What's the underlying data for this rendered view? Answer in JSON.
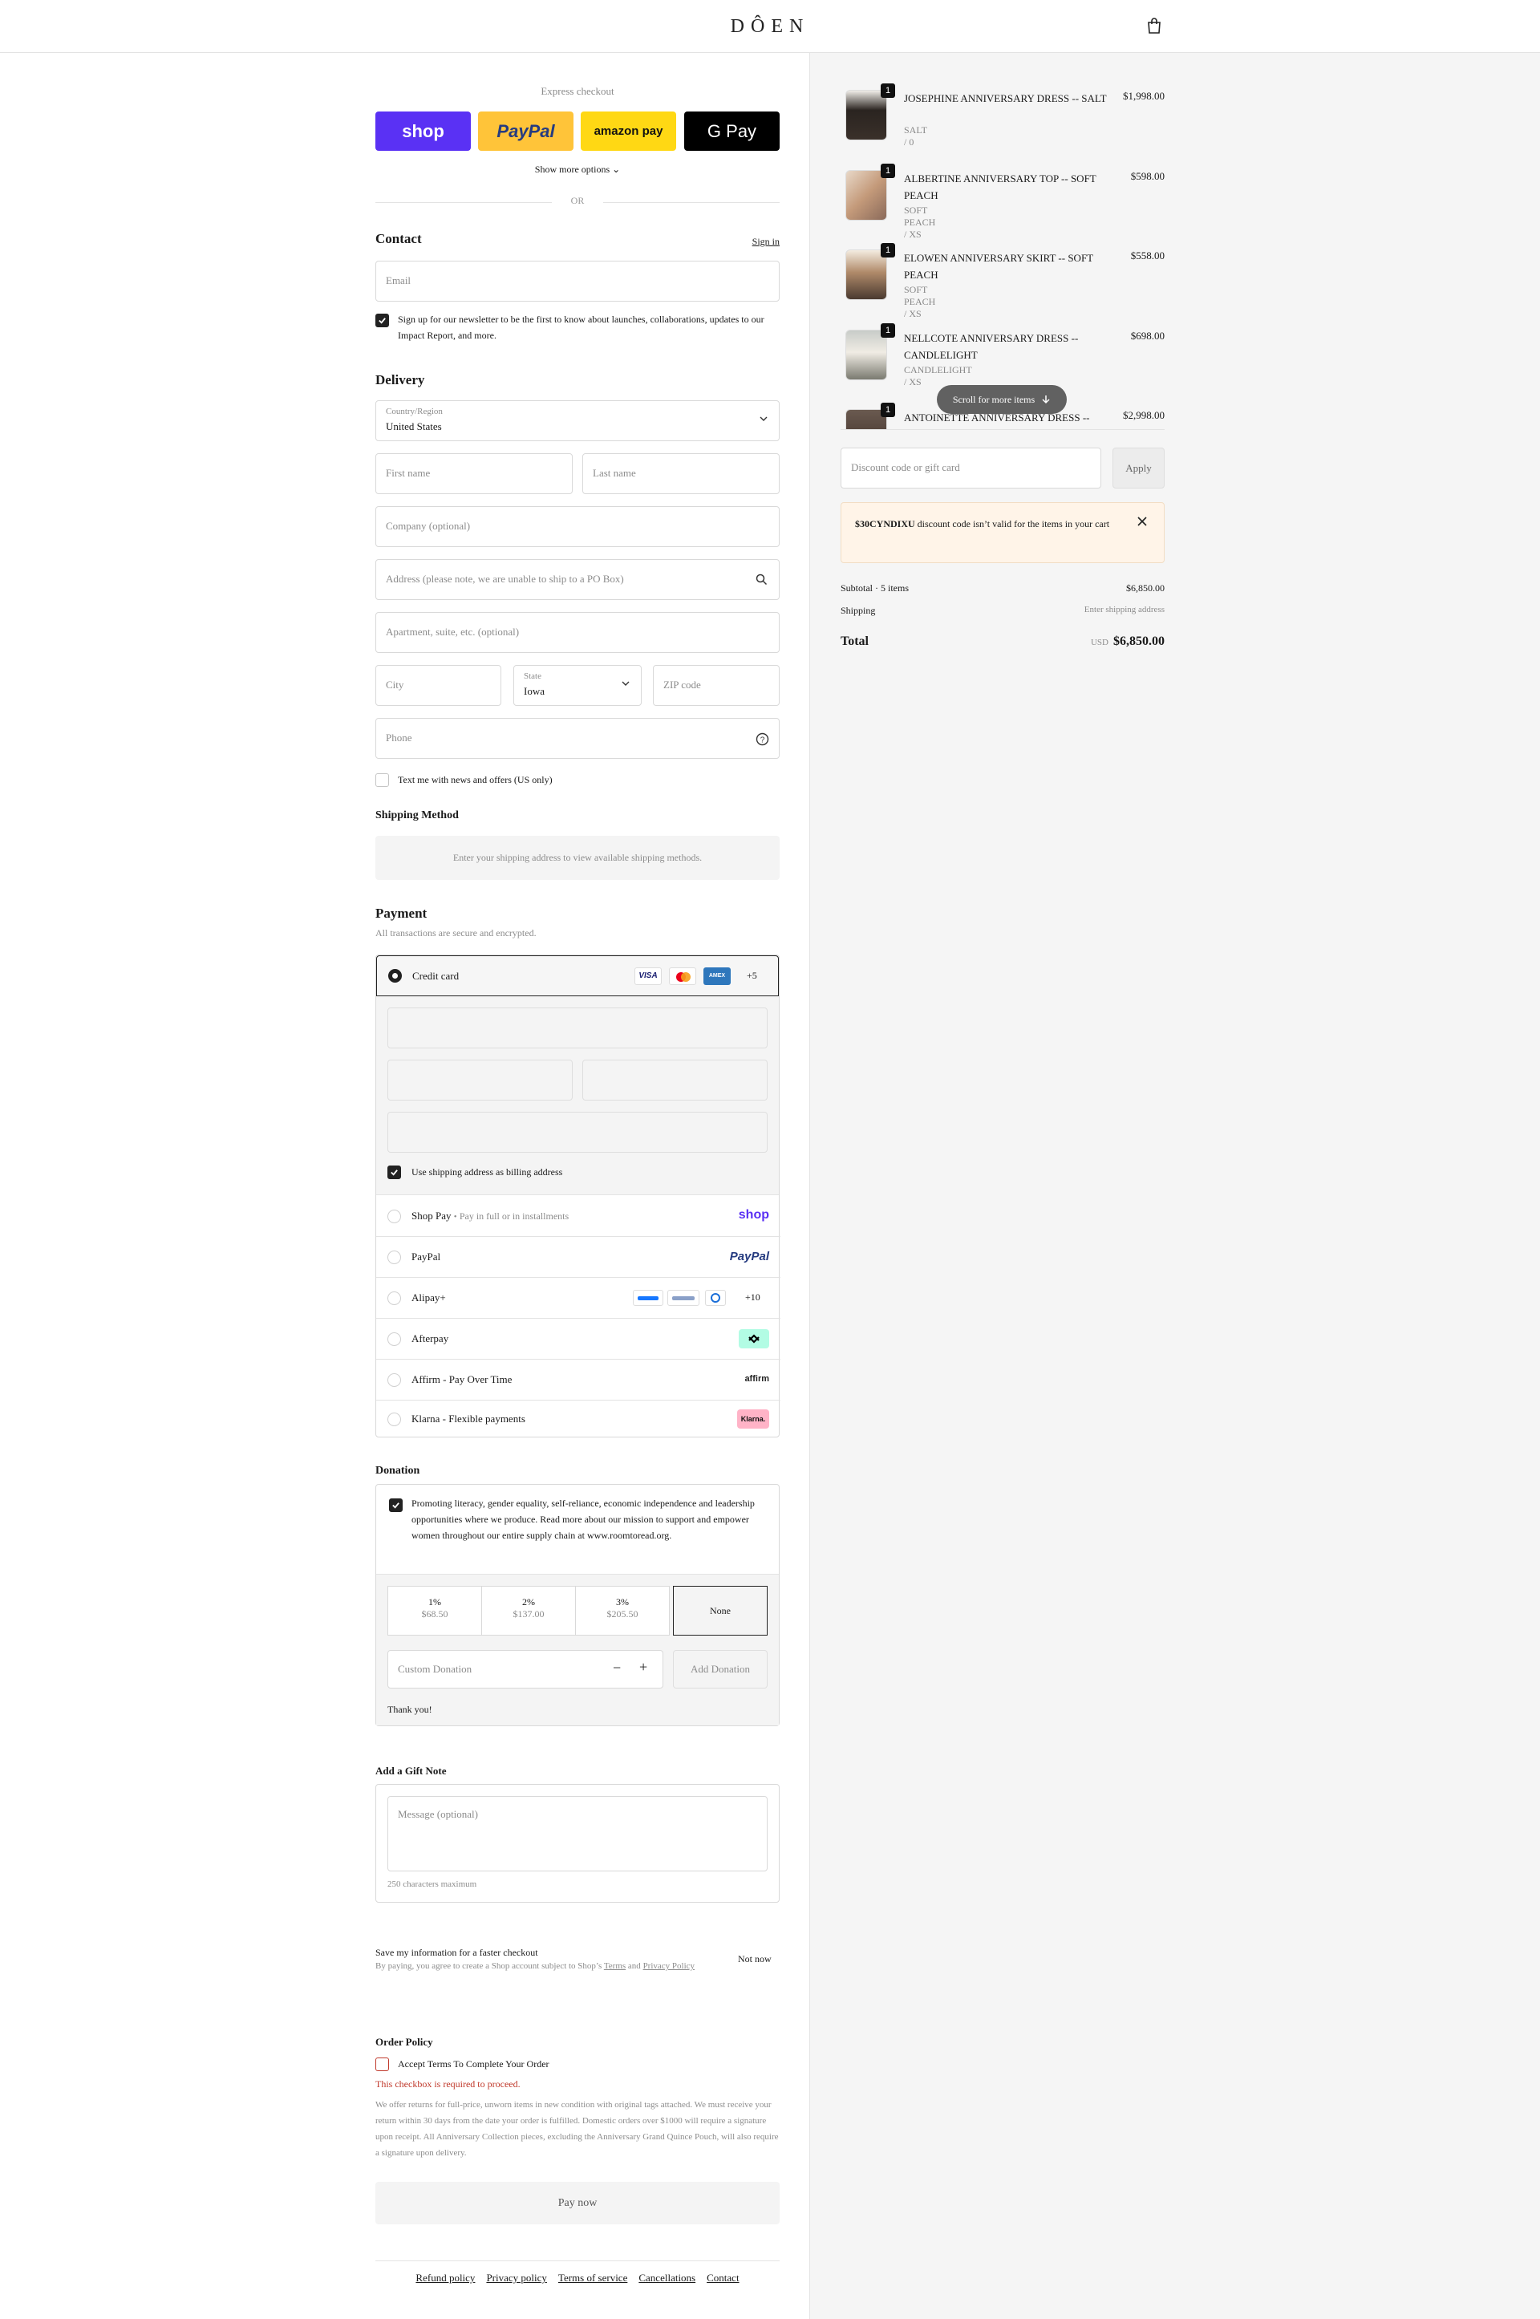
{
  "header": {
    "logo": "DÔEN",
    "cart_icon": "shopping-bag-icon"
  },
  "express": {
    "title": "Express checkout",
    "buttons": [
      {
        "label": "shop",
        "bg": "#5a31f4",
        "fg": "#ffffff"
      },
      {
        "label": "PayPal",
        "bg": "#ffc439",
        "fg": "#253b80"
      },
      {
        "label": "amazon pay",
        "bg": "#ffd814",
        "fg": "#111111"
      },
      {
        "label": "G Pay",
        "bg": "#000000",
        "fg": "#ffffff"
      }
    ],
    "show_more": "Show more options",
    "or": "OR"
  },
  "contact": {
    "title": "Contact",
    "sign_in": "Sign in",
    "email_placeholder": "Email",
    "newsletter": "Sign up for our newsletter to be the first to know about launches, collaborations, updates to our Impact Report, and more."
  },
  "delivery": {
    "title": "Delivery",
    "country_label": "Country/Region",
    "country_value": "United States",
    "first_name": "First name",
    "last_name": "Last name",
    "company": "Company (optional)",
    "address": "Address (please note, we are unable to ship to a PO Box)",
    "apartment": "Apartment, suite, etc. (optional)",
    "city": "City",
    "state_label": "State",
    "state_value": "Iowa",
    "zip": "ZIP code",
    "phone": "Phone",
    "text_me": "Text me with news and offers (US only)"
  },
  "shipping_method": {
    "title": "Shipping Method",
    "message": "Enter your shipping address to view available shipping methods."
  },
  "payment": {
    "title": "Payment",
    "subtitle": "All transactions are secure and encrypted.",
    "credit_card": "Credit card",
    "card_more": "+5",
    "billing_same": "Use shipping address as billing address",
    "shop_pay": "Shop Pay",
    "shop_pay_sub": "Pay in full or in installments",
    "shop_pay_logo": "shop",
    "paypal": "PayPal",
    "paypal_logo": "PayPal",
    "alipay": "Alipay+",
    "alipay_more": "+10",
    "afterpay": "Afterpay",
    "affirm": "Affirm - Pay Over Time",
    "affirm_logo": "affirm",
    "klarna": "Klarna - Flexible payments",
    "klarna_logo": "Klarna."
  },
  "donation": {
    "title": "Donation",
    "text": "Promoting literacy, gender equality, self-reliance, economic independence and leadership opportunities where we produce. Read more about our mission to support and empower women throughout our entire supply chain at www.roomtoread.org.",
    "options": [
      {
        "pct": "1%",
        "amt": "$68.50"
      },
      {
        "pct": "2%",
        "amt": "$137.00"
      },
      {
        "pct": "3%",
        "amt": "$205.50"
      },
      {
        "pct": "None",
        "amt": ""
      }
    ],
    "custom_placeholder": "Custom Donation",
    "add_label": "Add Donation",
    "thanks": "Thank you!"
  },
  "gift_note": {
    "title": "Add a Gift Note",
    "placeholder": "Message (optional)",
    "limit": "250 characters maximum"
  },
  "save_info": {
    "title": "Save my information for a faster checkout",
    "subtitle_prefix": "By paying, you agree to create a Shop account subject to Shop’s",
    "terms": "Terms",
    "and": "and",
    "privacy": "Privacy Policy",
    "not_now": "Not now"
  },
  "order_policy": {
    "title": "Order Policy",
    "accept": "Accept Terms To Complete Your Order",
    "error": "This checkbox is required to proceed.",
    "text": "We offer returns for full-price, unworn items in new condition with original tags attached. We must receive your return within 30 days from the date your order is fulfilled. Domestic orders over $1000 will require a signature upon receipt. All Anniversary Collection pieces, excluding the Anniversary Grand Quince Pouch, will also require a signature upon delivery."
  },
  "pay_now": "Pay now",
  "footer": [
    "Refund policy",
    "Privacy policy",
    "Terms of service",
    "Cancellations",
    "Contact"
  ],
  "cart": {
    "items": [
      {
        "name": "JOSEPHINE ANNIVERSARY DRESS -- SALT",
        "variant": "SALT / 0",
        "price": "$1,998.00",
        "qty": "1"
      },
      {
        "name": "ALBERTINE ANNIVERSARY TOP -- SOFT PEACH",
        "variant": "SOFT PEACH / XS",
        "price": "$598.00",
        "qty": "1"
      },
      {
        "name": "ELOWEN ANNIVERSARY SKIRT -- SOFT PEACH",
        "variant": "SOFT PEACH / XS",
        "price": "$558.00",
        "qty": "1"
      },
      {
        "name": "NELLCOTE ANNIVERSARY DRESS -- CANDLELIGHT",
        "variant": "CANDLELIGHT / XS",
        "price": "$698.00",
        "qty": "1"
      },
      {
        "name": "ANTOINETTE ANNIVERSARY DRESS --",
        "variant": "",
        "price": "$2,998.00",
        "qty": "1"
      }
    ],
    "scroll_hint": "Scroll for more items",
    "discount_placeholder": "Discount code or gift card",
    "apply": "Apply",
    "alert_code": "$30CYNDIXU",
    "alert_text": "discount code isn’t valid for the items in your cart",
    "subtotal_label": "Subtotal · 5 items",
    "subtotal": "$6,850.00",
    "shipping_label": "Shipping",
    "shipping_value": "Enter shipping address",
    "total_label": "Total",
    "currency": "USD",
    "total": "$6,850.00"
  }
}
